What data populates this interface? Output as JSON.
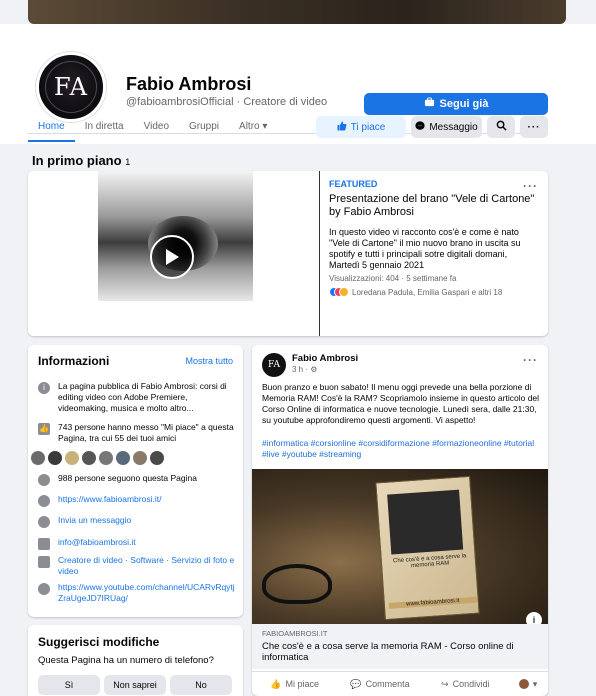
{
  "page": {
    "name": "Fabio Ambrosi",
    "handle": "@fabioambrosiOfficial · Creatore di video",
    "avatar_text": "FA",
    "follow_label": "Segui già"
  },
  "tabs": [
    {
      "label": "Home"
    },
    {
      "label": "In diretta"
    },
    {
      "label": "Video"
    },
    {
      "label": "Gruppi"
    },
    {
      "label": "Altro ▾"
    }
  ],
  "toolbar": {
    "like_label": "Ti piace",
    "message_label": "Messaggio"
  },
  "featured_section": {
    "title": "In primo piano",
    "count": "1"
  },
  "featured": {
    "label": "FEATURED",
    "title": "Presentazione del brano \"Vele di Cartone\" by Fabio Ambrosi",
    "body": "In questo video vi racconto cos'è e come è nato \"Vele di Cartone\" il mio nuovo brano in uscita su spotify e tutti i principali sotre digitali domani, Martedì 5 gennaio 2021",
    "meta": "Visualizzazioni: 404 · 5 settimane fa",
    "reactors": "Loredana Padula, Emilia Gaspari e altri 18"
  },
  "info": {
    "title": "Informazioni",
    "show_all": "Mostra tutto",
    "about": "La pagina pubblica di Fabio Ambrosi: corsi di editing video con Adobe Premiere, videomaking, musica e molto altro...",
    "likes": "743 persone hanno messo \"Mi piace\" a questa Pagina, tra cui 55 dei tuoi amici",
    "followers": "988 persone seguono questa Pagina",
    "website": "https://www.fabioambrosi.it/",
    "send_message": "Invia un messaggio",
    "email": "info@fabioambrosi.it",
    "categories": "Creatore di video · Software · Servizio di foto e video",
    "youtube": "https://www.youtube.com/channel/UCARvRqytjZraUgeJD7IRUag/"
  },
  "suggest": {
    "title": "Suggerisci modifiche",
    "question": "Questa Pagina ha un numero di telefono?",
    "yes": "Sì",
    "unsure": "Non saprei",
    "no": "No"
  },
  "post": {
    "author": "Fabio Ambrosi",
    "time": "3 h · ⚙",
    "text": "Buon pranzo e buon sabato! Il menu oggi prevede una bella porzione di Memoria RAM! Cos'è la RAM? Scopriamolo insieme in questo articolo del Corso Online di informatica e nuove tecnologie. Lunedì sera, dalle 21:30, su youtube approfondiremo questi argomenti. Vi aspetto!",
    "tags": "#informatica #corsionline #corsidiformazione #formazioneonline #tutorial #live #youtube #streaming",
    "image_book_label": "Che cos'è e a cosa serve la memoria RAM",
    "image_book_url": "www.fabioambrosi.it",
    "link_domain": "FABIOAMBROSI.IT",
    "link_title": "Che cos'è e a cosa serve la memoria RAM - Corso online di informatica",
    "like_label": "Mi piace",
    "comment_label": "Commenta",
    "share_label": "Condividi"
  }
}
